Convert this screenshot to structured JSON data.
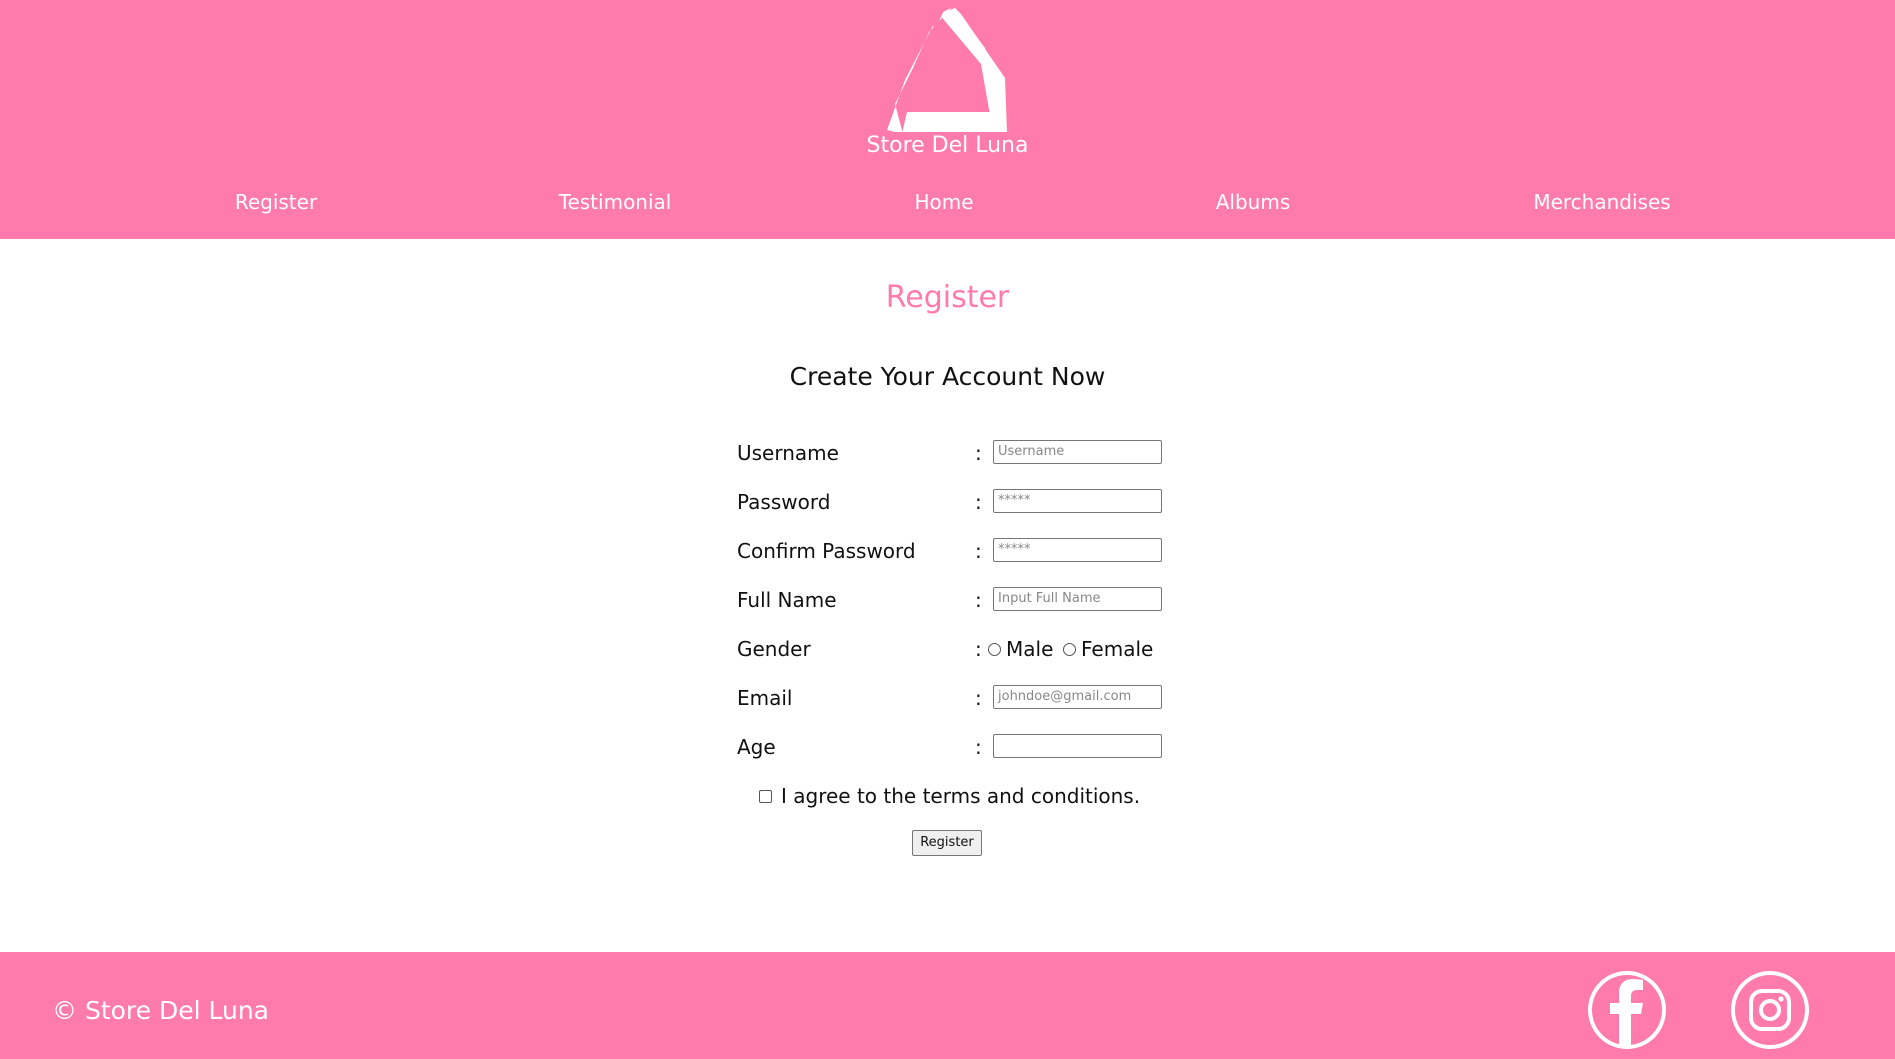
{
  "header": {
    "brand": "Store Del Luna",
    "logo_icon": "store-del-luna-logo",
    "nav": [
      {
        "label": "Register"
      },
      {
        "label": "Testimonial"
      },
      {
        "label": "Home"
      },
      {
        "label": "Albums"
      },
      {
        "label": "Merchandises"
      }
    ]
  },
  "main": {
    "title": "Register",
    "subtitle": "Create Your Account Now"
  },
  "form": {
    "colon": ":",
    "username": {
      "label": "Username",
      "placeholder": "Username",
      "value": ""
    },
    "password": {
      "label": "Password",
      "placeholder": "*****",
      "value": ""
    },
    "confirm_password": {
      "label": "Confirm Password",
      "placeholder": "*****",
      "value": ""
    },
    "full_name": {
      "label": "Full Name",
      "placeholder": "Input Full Name",
      "value": ""
    },
    "gender": {
      "label": "Gender",
      "options": [
        "Male",
        "Female"
      ],
      "selected": null
    },
    "email": {
      "label": "Email",
      "placeholder": "johndoe@gmail.com",
      "value": ""
    },
    "age": {
      "label": "Age",
      "placeholder": "",
      "value": ""
    },
    "terms": {
      "label": "I agree to the terms and conditions.",
      "checked": false
    },
    "submit_label": "Register"
  },
  "footer": {
    "copyright": "© Store Del Luna",
    "social": [
      {
        "icon": "facebook-icon"
      },
      {
        "icon": "instagram-icon"
      }
    ]
  },
  "colors": {
    "brand_pink": "#ff7bab",
    "text_dark": "#111111",
    "white": "#ffffff"
  }
}
